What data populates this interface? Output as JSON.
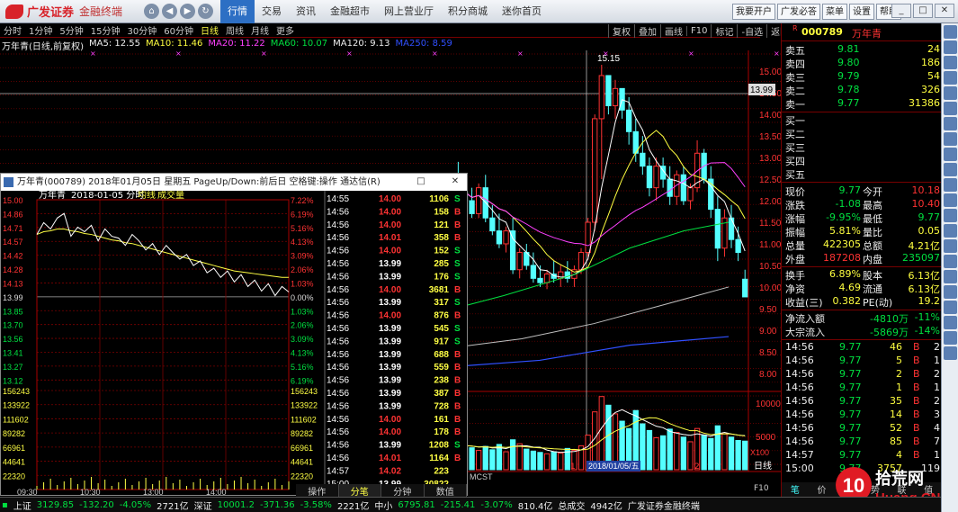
{
  "titlebar": {
    "brand": "广发证券",
    "product": "金融终端",
    "menu": [
      "行情",
      "交易",
      "资讯",
      "金融超市",
      "网上营业厅",
      "积分商城",
      "迷你首页"
    ],
    "active_menu": "行情",
    "right_buttons": [
      "我要开户",
      "广发必答",
      "菜单",
      "设置",
      "帮助"
    ]
  },
  "periods": [
    "分时",
    "1分钟",
    "5分钟",
    "15分钟",
    "30分钟",
    "60分钟",
    "日线",
    "周线",
    "月线",
    "更多"
  ],
  "active_period": "日线",
  "tools": [
    "复权",
    "叠加",
    "画线",
    "F10",
    "标记",
    "-自选",
    "返回"
  ],
  "ma": {
    "title": "万年青(日线,前复权)",
    "ma5": "MA5: 12.55",
    "ma10": "MA10: 11.46",
    "ma20": "MA20: 11.22",
    "ma60": "MA60: 10.07",
    "ma120": "MA120: 9.13",
    "ma250": "MA250: 8.59"
  },
  "price_axis": [
    "15.00",
    "14.50",
    "14.00",
    "13.50",
    "13.00",
    "12.50",
    "12.00",
    "11.50",
    "11.00",
    "10.50",
    "10.00",
    "9.50",
    "9.00",
    "8.50",
    "8.00"
  ],
  "crosshair_price": "13.99",
  "peak_label": "15.15",
  "volume_axis": [
    "10000",
    "5000"
  ],
  "vol_unit": "X100",
  "date_axis": {
    "mark1": "1",
    "current": "2018/01/05/五",
    "mark2": "2",
    "tab": "日线",
    "f10": "F10",
    "mcst": "MCST"
  },
  "stock": {
    "code": "000789",
    "name": "万年青",
    "flag": "R"
  },
  "orderbook": {
    "asks": [
      {
        "l": "卖五",
        "p": "9.81",
        "v": "24"
      },
      {
        "l": "卖四",
        "p": "9.80",
        "v": "186"
      },
      {
        "l": "卖三",
        "p": "9.79",
        "v": "54"
      },
      {
        "l": "卖二",
        "p": "9.78",
        "v": "326"
      },
      {
        "l": "卖一",
        "p": "9.77",
        "v": "31386"
      }
    ],
    "bids": [
      {
        "l": "买一",
        "p": "",
        "v": ""
      },
      {
        "l": "买二",
        "p": "",
        "v": ""
      },
      {
        "l": "买三",
        "p": "",
        "v": ""
      },
      {
        "l": "买四",
        "p": "",
        "v": ""
      },
      {
        "l": "买五",
        "p": "",
        "v": ""
      }
    ]
  },
  "stats": [
    {
      "l1": "现价",
      "v1": "9.77",
      "l2": "今开",
      "v2": "10.18"
    },
    {
      "l1": "涨跌",
      "v1": "-1.08",
      "l2": "最高",
      "v2": "10.40"
    },
    {
      "l1": "涨幅",
      "v1": "-9.95%",
      "l2": "最低",
      "v2": "9.77"
    },
    {
      "l1": "振幅",
      "v1": "5.81%",
      "l2": "量比",
      "v2": "0.05"
    },
    {
      "l1": "总量",
      "v1": "422305",
      "l2": "总额",
      "v2": "4.21亿"
    },
    {
      "l1": "外盘",
      "v1": "187208",
      "l2": "内盘",
      "v2": "235097"
    },
    {
      "l1": "换手",
      "v1": "6.89%",
      "l2": "股本",
      "v2": "6.13亿"
    },
    {
      "l1": "净资",
      "v1": "4.69",
      "l2": "流通",
      "v2": "6.13亿"
    },
    {
      "l1": "收益(三)",
      "v1": "0.382",
      "l2": "PE(动)",
      "v2": "19.2"
    }
  ],
  "flow": [
    {
      "l": "净流入额",
      "v": "-4810万",
      "p": "-11%"
    },
    {
      "l": "大宗流入",
      "v": "-5869万",
      "p": "-14%"
    }
  ],
  "ticks_right": [
    {
      "t": "14:56",
      "p": "9.77",
      "v": "46",
      "s": "B",
      "n": "2"
    },
    {
      "t": "14:56",
      "p": "9.77",
      "v": "5",
      "s": "B",
      "n": "1"
    },
    {
      "t": "14:56",
      "p": "9.77",
      "v": "2",
      "s": "B",
      "n": "2"
    },
    {
      "t": "14:56",
      "p": "9.77",
      "v": "1",
      "s": "B",
      "n": "1"
    },
    {
      "t": "14:56",
      "p": "9.77",
      "v": "35",
      "s": "B",
      "n": "2"
    },
    {
      "t": "14:56",
      "p": "9.77",
      "v": "14",
      "s": "B",
      "n": "3"
    },
    {
      "t": "14:56",
      "p": "9.77",
      "v": "52",
      "s": "B",
      "n": "4"
    },
    {
      "t": "14:56",
      "p": "9.77",
      "v": "85",
      "s": "B",
      "n": "7"
    },
    {
      "t": "14:57",
      "p": "9.77",
      "v": "4",
      "s": "B",
      "n": "1"
    },
    {
      "t": "15:00",
      "p": "9.77",
      "v": "3757",
      "s": "",
      "n": "119"
    }
  ],
  "popup": {
    "title": "万年青(000789)  2018年01月05日 星期五 PageUp/Down:前后日 空格键:操作 通达信(R)",
    "header_name": "万年青",
    "header_date": "2018-01-05 分时",
    "header_avg": "均线",
    "header_vol": "成交量",
    "left_axis": [
      "15.00",
      "14.86",
      "14.71",
      "14.57",
      "14.42",
      "14.28",
      "14.13",
      "13.99",
      "13.85",
      "13.70",
      "13.56",
      "13.41",
      "13.27",
      "13.12"
    ],
    "right_axis": [
      "7.22%",
      "6.19%",
      "5.16%",
      "4.13%",
      "3.09%",
      "2.06%",
      "1.03%",
      "0.00%",
      "1.03%",
      "2.06%",
      "3.09%",
      "4.13%",
      "5.16%",
      "6.19%"
    ],
    "vol_axis": [
      "156243",
      "133922",
      "111602",
      "89282",
      "66961",
      "44641",
      "22320"
    ],
    "time_axis": [
      "09:30",
      "10:30",
      "13:00",
      "14:00"
    ],
    "tabs": [
      "操作",
      "分笔",
      "分钟",
      "数值"
    ],
    "active_tab": "分笔",
    "ticks": [
      {
        "t": "14:55",
        "p": "14.00",
        "v": "1106",
        "s": "S"
      },
      {
        "t": "14:56",
        "p": "14.00",
        "v": "158",
        "s": "B"
      },
      {
        "t": "14:56",
        "p": "14.00",
        "v": "121",
        "s": "B"
      },
      {
        "t": "14:56",
        "p": "14.01",
        "v": "358",
        "s": "B"
      },
      {
        "t": "14:56",
        "p": "14.00",
        "v": "152",
        "s": "S"
      },
      {
        "t": "14:56",
        "p": "13.99",
        "v": "285",
        "s": "S"
      },
      {
        "t": "14:56",
        "p": "13.99",
        "v": "176",
        "s": "S"
      },
      {
        "t": "14:56",
        "p": "14.00",
        "v": "3681",
        "s": "B"
      },
      {
        "t": "14:56",
        "p": "13.99",
        "v": "317",
        "s": "S"
      },
      {
        "t": "14:56",
        "p": "14.00",
        "v": "876",
        "s": "B"
      },
      {
        "t": "14:56",
        "p": "13.99",
        "v": "545",
        "s": "S"
      },
      {
        "t": "14:56",
        "p": "13.99",
        "v": "917",
        "s": "S"
      },
      {
        "t": "14:56",
        "p": "13.99",
        "v": "688",
        "s": "B"
      },
      {
        "t": "14:56",
        "p": "13.99",
        "v": "559",
        "s": "B"
      },
      {
        "t": "14:56",
        "p": "13.99",
        "v": "238",
        "s": "B"
      },
      {
        "t": "14:56",
        "p": "13.99",
        "v": "387",
        "s": "B"
      },
      {
        "t": "14:56",
        "p": "13.99",
        "v": "728",
        "s": "B"
      },
      {
        "t": "14:56",
        "p": "14.00",
        "v": "161",
        "s": "B"
      },
      {
        "t": "14:56",
        "p": "14.00",
        "v": "178",
        "s": "B"
      },
      {
        "t": "14:56",
        "p": "13.99",
        "v": "1208",
        "s": "S"
      },
      {
        "t": "14:56",
        "p": "14.01",
        "v": "1164",
        "s": "B"
      },
      {
        "t": "14:57",
        "p": "14.02",
        "v": "223",
        "s": ""
      },
      {
        "t": "15:00",
        "p": "13.99",
        "v": "30822",
        "s": ""
      }
    ]
  },
  "status": {
    "sh_label": "上证",
    "sh_val": "3129.85",
    "sh_chg": "-132.20",
    "sh_pct": "-4.05%",
    "sh_amt": "2721亿",
    "sz_label": "深证",
    "sz_val": "10001.2",
    "sz_chg": "-371.36",
    "sz_pct": "-3.58%",
    "sz_amt": "2221亿",
    "zx_label": "中小",
    "zx_val": "6795.81",
    "zx_chg": "-215.41",
    "zx_pct": "-3.07%",
    "zx_amt": "810.4亿",
    "total_label": "总成交",
    "total_val": "4942亿",
    "company": "广发证券金融终端"
  },
  "right_tabs": [
    "笔",
    "价",
    "细",
    "势",
    "联",
    "值"
  ],
  "watermark": {
    "text1": "10",
    "text2": "拾荒网",
    "text3": "Huang.CN"
  },
  "colors": {
    "up": "#ff3333",
    "down": "#00e040",
    "ma5": "#ffffff",
    "ma10": "#ffff40",
    "ma20": "#ff40ff",
    "ma60": "#00e040",
    "ma120": "#c0c0c0",
    "ma250": "#3050ff",
    "candle_down": "#54ffff",
    "grid": "#7a0000"
  },
  "chart_data": {
    "type": "candlestick",
    "price_range": [
      7.6,
      15.4
    ],
    "candles": [
      [
        12.1,
        12.5,
        11.8,
        12.4
      ],
      [
        12.4,
        12.9,
        12.1,
        12.2
      ],
      [
        12.2,
        12.5,
        11.9,
        12.0
      ],
      [
        12.0,
        12.3,
        11.6,
        11.7
      ],
      [
        11.7,
        12.4,
        11.6,
        12.3
      ],
      [
        12.3,
        12.6,
        11.5,
        11.6
      ],
      [
        11.6,
        11.9,
        11.2,
        11.3
      ],
      [
        11.3,
        11.7,
        10.9,
        11.0
      ],
      [
        11.0,
        11.4,
        10.8,
        11.3
      ],
      [
        11.3,
        11.6,
        10.3,
        10.4
      ],
      [
        10.4,
        10.9,
        10.2,
        10.8
      ],
      [
        10.8,
        11.0,
        10.4,
        10.5
      ],
      [
        10.5,
        10.8,
        10.1,
        10.2
      ],
      [
        10.2,
        10.5,
        10.0,
        10.1
      ],
      [
        10.1,
        10.4,
        9.95,
        10.3
      ],
      [
        10.3,
        10.6,
        10.1,
        10.2
      ],
      [
        10.2,
        10.5,
        10.0,
        10.35
      ],
      [
        10.35,
        10.6,
        10.1,
        10.2
      ],
      [
        10.2,
        10.5,
        10.0,
        10.4
      ],
      [
        10.4,
        10.9,
        10.3,
        10.8
      ],
      [
        10.8,
        11.6,
        10.7,
        11.5
      ],
      [
        11.5,
        14.0,
        11.3,
        13.9
      ],
      [
        13.9,
        15.15,
        12.5,
        14.9
      ],
      [
        14.9,
        14.9,
        14.0,
        14.2
      ],
      [
        14.2,
        14.8,
        13.9,
        14.6
      ],
      [
        14.6,
        14.6,
        13.9,
        14.1
      ],
      [
        14.1,
        14.4,
        13.3,
        13.6
      ],
      [
        13.6,
        13.9,
        12.9,
        13.1
      ],
      [
        13.1,
        13.5,
        12.6,
        12.8
      ],
      [
        12.8,
        13.0,
        12.1,
        12.3
      ],
      [
        12.3,
        13.0,
        12.0,
        12.8
      ],
      [
        12.8,
        13.0,
        12.3,
        12.5
      ],
      [
        12.5,
        12.8,
        11.9,
        12.1
      ],
      [
        12.1,
        12.7,
        11.9,
        12.6
      ],
      [
        12.6,
        12.8,
        11.9,
        12.0
      ],
      [
        12.0,
        12.4,
        11.8,
        12.3
      ],
      [
        12.3,
        13.4,
        12.2,
        13.1
      ],
      [
        13.1,
        13.2,
        12.4,
        12.5
      ],
      [
        12.5,
        12.8,
        11.6,
        11.8
      ],
      [
        11.8,
        12.1,
        10.6,
        10.9
      ],
      [
        10.9,
        11.8,
        10.7,
        11.6
      ],
      [
        11.6,
        11.9,
        10.9,
        11.1
      ],
      [
        11.1,
        11.4,
        10.6,
        10.8
      ],
      [
        10.18,
        10.4,
        9.77,
        9.77
      ]
    ],
    "volumes": [
      3200,
      4100,
      3600,
      3300,
      2900,
      3500,
      3000,
      3800,
      2700,
      4500,
      3900,
      3100,
      2800,
      2600,
      2400,
      2700,
      2500,
      3200,
      2900,
      3600,
      5200,
      8700,
      11000,
      9700,
      8400,
      7300,
      6200,
      8900,
      6900,
      5900,
      4800,
      5100,
      6100,
      5600,
      4900,
      4200,
      6200,
      5200,
      4700,
      6600,
      5400,
      4900,
      4400,
      4300
    ],
    "intraday_price": [
      14.62,
      14.75,
      14.68,
      14.8,
      14.85,
      14.6,
      14.7,
      14.65,
      14.72,
      14.55,
      14.68,
      14.6,
      14.58,
      14.5,
      14.62,
      14.55,
      14.45,
      14.52,
      14.4,
      14.5,
      14.42,
      14.35,
      14.4,
      14.28,
      14.33,
      14.2,
      14.25,
      14.15,
      14.22,
      14.1,
      14.18,
      14.05,
      14.12,
      14.0,
      14.08,
      13.95,
      14.05,
      13.99
    ],
    "intraday_avg": [
      14.62,
      14.65,
      14.66,
      14.68,
      14.68,
      14.66,
      14.65,
      14.63,
      14.62,
      14.6,
      14.58,
      14.56,
      14.55,
      14.53,
      14.52,
      14.5,
      14.48,
      14.46,
      14.44,
      14.42,
      14.4,
      14.38,
      14.36,
      14.34,
      14.32,
      14.3,
      14.28,
      14.26,
      14.24,
      14.22,
      14.21,
      14.2,
      14.19,
      14.18,
      14.17,
      14.16,
      14.15,
      14.15
    ]
  }
}
